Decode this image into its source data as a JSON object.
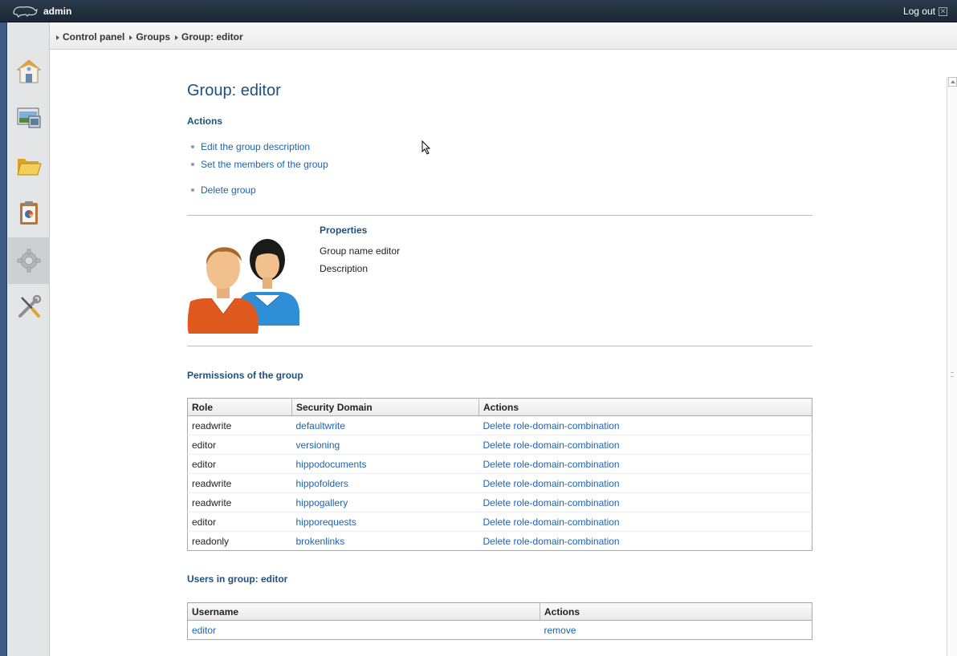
{
  "topbar": {
    "user": "admin",
    "logout_label": "Log out"
  },
  "breadcrumb": [
    "Control panel",
    "Groups",
    "Group: editor"
  ],
  "sidebar": {
    "items": [
      {
        "name": "home",
        "icon": "house-icon"
      },
      {
        "name": "channels",
        "icon": "pictures-icon"
      },
      {
        "name": "documents",
        "icon": "folder-icon"
      },
      {
        "name": "reports",
        "icon": "clipboard-chart-icon"
      },
      {
        "name": "admin",
        "icon": "gear-icon",
        "active": true
      },
      {
        "name": "tools",
        "icon": "wrench-screwdriver-icon"
      }
    ]
  },
  "page": {
    "title": "Group: editor",
    "actions_heading": "Actions",
    "actions": [
      "Edit the group description",
      "Set the members of the group",
      "Delete group"
    ],
    "properties_heading": "Properties",
    "group_name_label": "Group name",
    "group_name_value": "editor",
    "description_label": "Description",
    "permissions_heading": "Permissions of the group",
    "permissions_columns": [
      "Role",
      "Security Domain",
      "Actions"
    ],
    "permissions": [
      {
        "role": "readwrite",
        "domain": "defaultwrite",
        "action": "Delete role-domain-combination"
      },
      {
        "role": "editor",
        "domain": "versioning",
        "action": "Delete role-domain-combination"
      },
      {
        "role": "editor",
        "domain": "hippodocuments",
        "action": "Delete role-domain-combination"
      },
      {
        "role": "readwrite",
        "domain": "hippofolders",
        "action": "Delete role-domain-combination"
      },
      {
        "role": "readwrite",
        "domain": "hippogallery",
        "action": "Delete role-domain-combination"
      },
      {
        "role": "editor",
        "domain": "hipporequests",
        "action": "Delete role-domain-combination"
      },
      {
        "role": "readonly",
        "domain": "brokenlinks",
        "action": "Delete role-domain-combination"
      }
    ],
    "users_heading": "Users in group: editor",
    "users_columns": [
      "Username",
      "Actions"
    ],
    "users": [
      {
        "username": "editor",
        "action": "remove"
      }
    ]
  }
}
